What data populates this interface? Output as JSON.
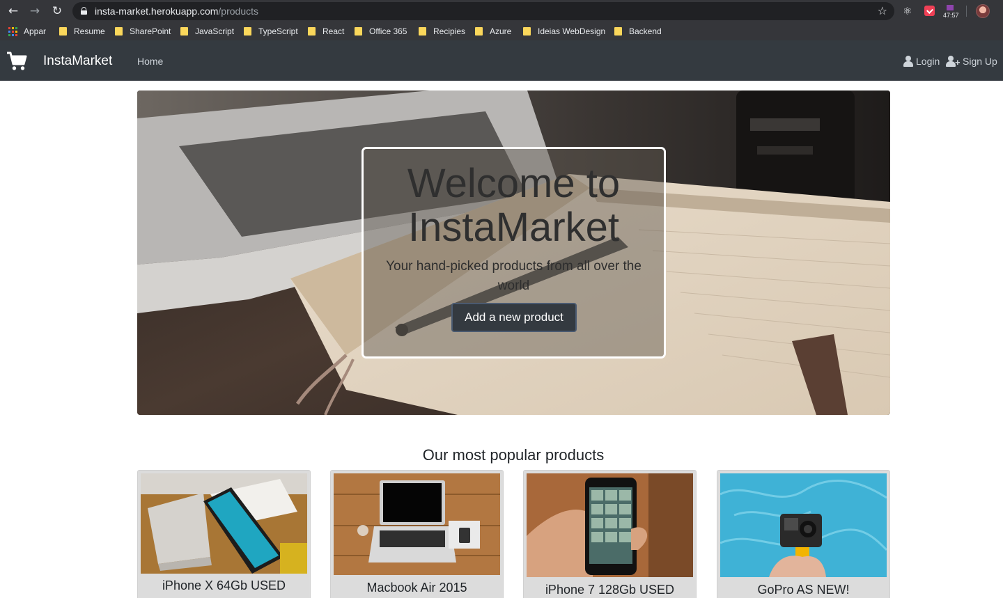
{
  "browser": {
    "url_host": "insta-market.herokuapp.com",
    "url_path": "/products",
    "timer_badge": "47:57",
    "bookmarks": [
      "Appar",
      "Resume",
      "SharePoint",
      "JavaScript",
      "TypeScript",
      "React",
      "Office 365",
      "Recipies",
      "Azure",
      "Ideias WebDesign",
      "Backend"
    ],
    "icons": [
      "back-arrow-icon",
      "forward-arrow-icon",
      "reload-icon",
      "lock-icon",
      "star-icon",
      "react-devtools-icon",
      "pocket-icon",
      "timer-icon",
      "profile-avatar"
    ]
  },
  "navbar": {
    "brand": "InstaMarket",
    "home": "Home",
    "login": "Login",
    "signup": "Sign Up",
    "background": "#343a40"
  },
  "hero": {
    "title": "Welcome to InstaMarket",
    "subtitle": "Your hand-picked products from all over the world",
    "button": "Add a new product"
  },
  "products": {
    "heading": "Our most popular products",
    "items": [
      {
        "name": "iPhone X 64Gb USED"
      },
      {
        "name": "Macbook Air 2015"
      },
      {
        "name": "iPhone 7 128Gb USED"
      },
      {
        "name": "GoPro AS NEW!"
      }
    ]
  }
}
